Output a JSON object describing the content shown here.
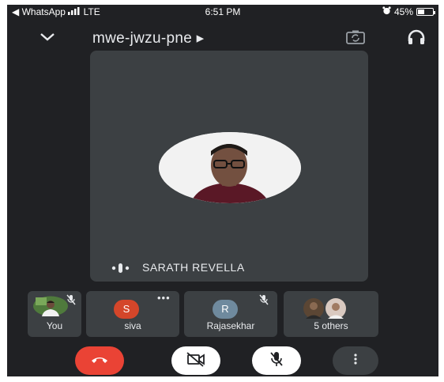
{
  "status_bar": {
    "back_label": "◀ WhatsApp",
    "network": "LTE",
    "time": "6:51 PM",
    "battery": "45%",
    "battery_level": 0.45
  },
  "header": {
    "meeting_code": "mwe-jwzu-pne ▸"
  },
  "main_tile": {
    "speaker_name": "SARATH REVELLA"
  },
  "participants": [
    {
      "name": "You",
      "muted": true
    },
    {
      "name": "siva",
      "initial": "S",
      "color": "#d4462a"
    },
    {
      "name": "Rajasekhar",
      "initial": "R",
      "color": "#6f8a9e",
      "muted": true
    },
    {
      "name": "5 others"
    }
  ],
  "colors": {
    "background": "#202124",
    "tile": "#3c4043",
    "end_call": "#ea4335"
  }
}
